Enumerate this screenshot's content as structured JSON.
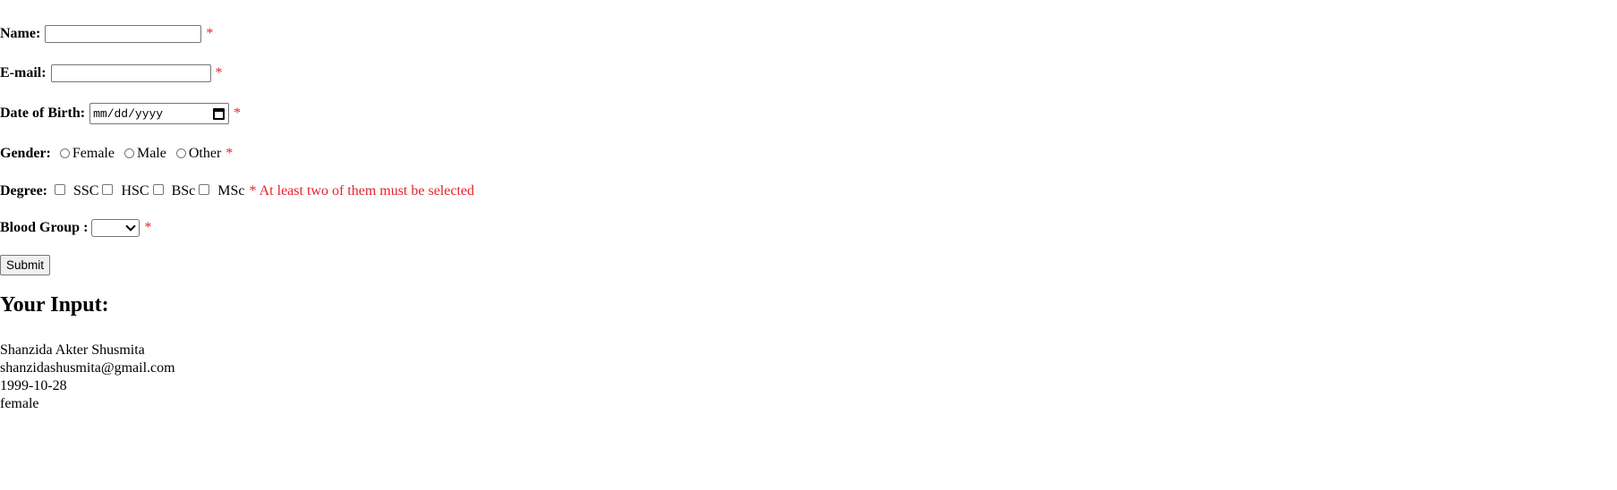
{
  "form": {
    "name": {
      "label": "Name:",
      "value": "",
      "required": "*"
    },
    "email": {
      "label": "E-mail:",
      "value": "",
      "required": "*"
    },
    "dob": {
      "label": "Date of Birth:",
      "placeholder": "mm/dd/yyyy",
      "required": "*"
    },
    "gender": {
      "label": "Gender:",
      "options": [
        "Female",
        "Male",
        "Other"
      ],
      "required": "*"
    },
    "degree": {
      "label": "Degree:",
      "options": [
        "SSC",
        "HSC",
        "BSc",
        "MSc"
      ],
      "note": "* At least two of them must be selected"
    },
    "blood_group": {
      "label": "Blood Group :",
      "selected": "",
      "required": "*"
    },
    "submit_label": "Submit"
  },
  "output": {
    "heading": "Your Input:",
    "lines": [
      "Shanzida Akter Shusmita",
      "shanzidashusmita@gmail.com",
      "1999-10-28",
      "female"
    ]
  },
  "colors": {
    "required": "#e8202a"
  }
}
